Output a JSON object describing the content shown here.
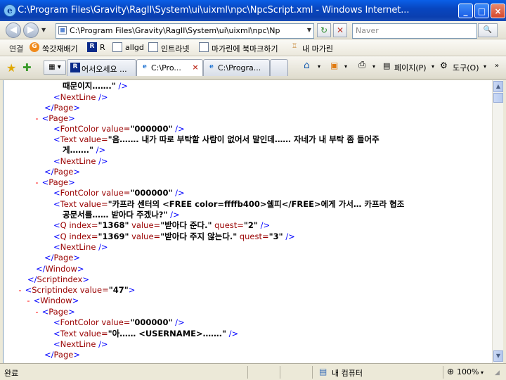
{
  "window": {
    "title": "C:\\Program Files\\Gravity\\RagII\\System\\ui\\uixml\\npc\\NpcScript.xml - Windows Internet...",
    "minimize": "_",
    "maximize": "□",
    "close": "×"
  },
  "addressbar": {
    "url": "C:\\Program Files\\Gravity\\RagII\\System\\ui\\uixml\\npc\\Np",
    "search_placeholder": "Naver",
    "back": "◀",
    "forward": "▶",
    "refresh": "↻",
    "stop": "✕",
    "search_go": "🔍"
  },
  "links": {
    "label": "연결",
    "items": [
      "쑥갓재배기",
      "R",
      "allgd",
      "인트라넷",
      "마가린에 북마크하기",
      "내 마가린"
    ]
  },
  "tabs": {
    "tab1": "어서오세요 ...",
    "tab2": "C:\\Pro...",
    "tab3": "C:\\Progra..."
  },
  "commands": {
    "page": "페이지(P)",
    "tools": "도구(O)"
  },
  "xml": {
    "fontcolor_attr": "value=",
    "fontcolor_val": "\"000000\"",
    "text_attr": "value=",
    "text1_tail": "때문이지…….\"",
    "text2_a": "\"음…….  내가 따로 부탁할 사람이 없어서 말인데…… 자네가 내 부탁 좀 들어주",
    "text2_b": "게…….\"",
    "text3_a": "\"카프라 센터의 <FREE color=ffffb400>쉘피</FREE>에게 가서… 카프라 협조",
    "text3_b": "공문서를…… 받아다 주겠나?\"",
    "q1_index": "\"1368\"",
    "q1_value": "\"받아다 준다.\"",
    "q1_quest": "\"2\"",
    "q2_index": "\"1369\"",
    "q2_value": "\"받아다 주지 않는다.\"",
    "q2_quest": "\"3\"",
    "scriptindex_value": "\"47\"",
    "text4": "\"아…… <USERNAME>…….\""
  },
  "status": {
    "text": "완료",
    "zone": "내 컴퓨터",
    "zoom": "100%"
  },
  "colors": {
    "tag": "#990000",
    "bracket": "#0000ff",
    "collapse": "#ff0000",
    "titlebar": "#0a4fd8"
  }
}
